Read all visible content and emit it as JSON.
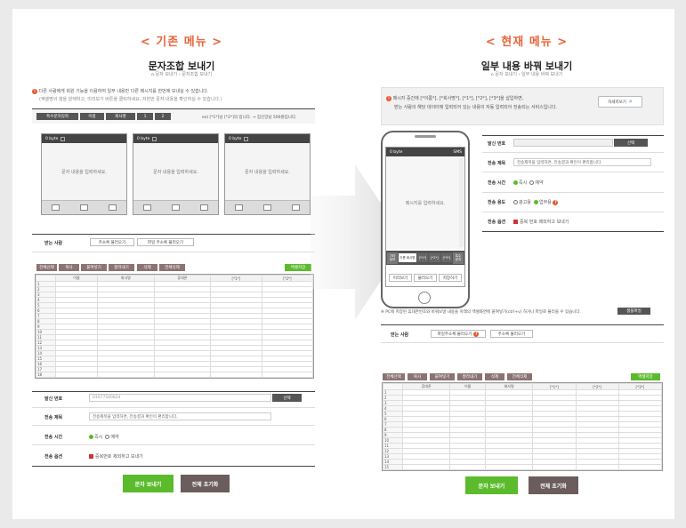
{
  "left": {
    "section_title": "< 기존 메뉴 >",
    "page_title": "문자조합 보내기",
    "breadcrumb": "⌂ 문자 보내기 › 문자조합 보내기",
    "notice_line1": "다른 사람에게 회원 기능을 이용하여 일부 내용만 다른 메시지를 한번에 보내실 수 있습니다.",
    "notice_line2": "(엑셀명의 행을 원택하고, 미리보기 버튼을 클릭하세요, 저한번 문자 내용을 확인하실 수 있습니다.)",
    "toolbar_buttons": [
      "특수문자입력",
      "이름",
      "회사명",
      "1",
      "2"
    ],
    "toolbar_hint": "ex) [*1*]님 [*2*]의 입니다. → 집신앙님 500원입니다.",
    "msg_byte": "0 byte",
    "msg_placeholder": "문자 내용을 입력하세요.",
    "recipients_label": "받는 사람",
    "recipients_buttons": [
      "주소록 불러오기",
      "파일 주소록 불러오기"
    ],
    "grid_buttons": [
      "전체선택",
      "복사",
      "붙여넣기",
      "잘라내기",
      "삭제",
      "전체삭제"
    ],
    "excel_button": "엑셀저장",
    "grid_headers": [
      "",
      "이름",
      "회사명",
      "휴대폰",
      "[*1*]",
      "[*2*]"
    ],
    "row_numbers": [
      "1",
      "2",
      "3",
      "4",
      "5",
      "6",
      "7",
      "8",
      "9",
      "10",
      "11",
      "12",
      "13",
      "14",
      "15",
      "16",
      "17",
      "18",
      "19",
      "20"
    ],
    "sender_label": "발신 번호",
    "sender_value": "01077500824",
    "select_button": "선택",
    "subject_label": "전송 제목",
    "subject_value": "전송제목을 입력하면, 전송결과 확인이 편리합니다.",
    "time_label": "전송 시간",
    "time_options": [
      "즉시",
      "예약"
    ],
    "options_label": "전송 옵션",
    "options_value": "중복번호 제외하고 보내기",
    "send_button": "문자 보내기",
    "reset_button": "전체 초기화"
  },
  "right": {
    "section_title": "< 현재 메뉴 >",
    "page_title": "일부 내용 바꿔 보내기",
    "breadcrumb": "⌂ 문자 보내기 › 일부 내용 바꿔 보내기",
    "notice_line1": "메시지 중간에 [*이름*], [*회사명*], [*1*], [*2*], [*3*]을 삽입하면,",
    "notice_line2": "받는 사람의 해당 데이터에 입력되어 있는 내용이 자동 입력되어 전송되는 서비스입니다.",
    "detail_button": "자세히보기",
    "phone_byte": "0 byte",
    "phone_type": "SMS",
    "phone_placeholder": "메시지를 입력하세요.",
    "phone_tabs": [
      "기타\n정보",
      "이름 회사명",
      "[*1*]",
      "[*2*]",
      "[*3*]",
      "특수\n문자"
    ],
    "phone_buttons": [
      "미리보기",
      "불러오기",
      "저장하기"
    ],
    "sender_label": "발신 번호",
    "select_button": "선택",
    "subject_label": "전송 제목",
    "subject_value": "전송제목을 입력하면, 전송결과 확인이 편리합니다.",
    "time_label": "전송 시간",
    "time_options": [
      "즉시",
      "예약"
    ],
    "purpose_label": "전송 용도",
    "purpose_options": [
      "광고용",
      "업무용"
    ],
    "options_label": "전송 옵션",
    "options_value": "중복 번호 제외하고 보내기",
    "pc_notice": "※ PC에 저장된 휴대폰번호와 바꿔보낼 내용을 아래의 엑셀화면에 붙여넣기(ctrl+v) 하거나 파일로 불러올 수 있습니다.",
    "sample_button": "샘플파일",
    "recipients_label": "받는 사람",
    "recipients_buttons": [
      "파일주소록 불러오기",
      "주소록 불러오기"
    ],
    "grid_buttons": [
      "전체선택",
      "복사",
      "붙여넣기",
      "잘라내기",
      "삭제",
      "전체삭제"
    ],
    "excel_button": "엑셀저장",
    "grid_headers": [
      "",
      "휴대폰",
      "이름",
      "회사명",
      "[*1*]",
      "[*2*]",
      "[*3*]"
    ],
    "row_numbers": [
      "1",
      "2",
      "3",
      "4",
      "5",
      "6",
      "7",
      "8",
      "9",
      "10",
      "11",
      "12",
      "13",
      "14",
      "15",
      "16",
      "17",
      "18",
      "19",
      "20"
    ],
    "send_button": "문자 보내기",
    "reset_button": "전체 초기화"
  },
  "colors": {
    "accent": "#e8663d",
    "green": "#5bbb2c",
    "dark_button": "#555555",
    "reset": "#6b5d5d"
  }
}
